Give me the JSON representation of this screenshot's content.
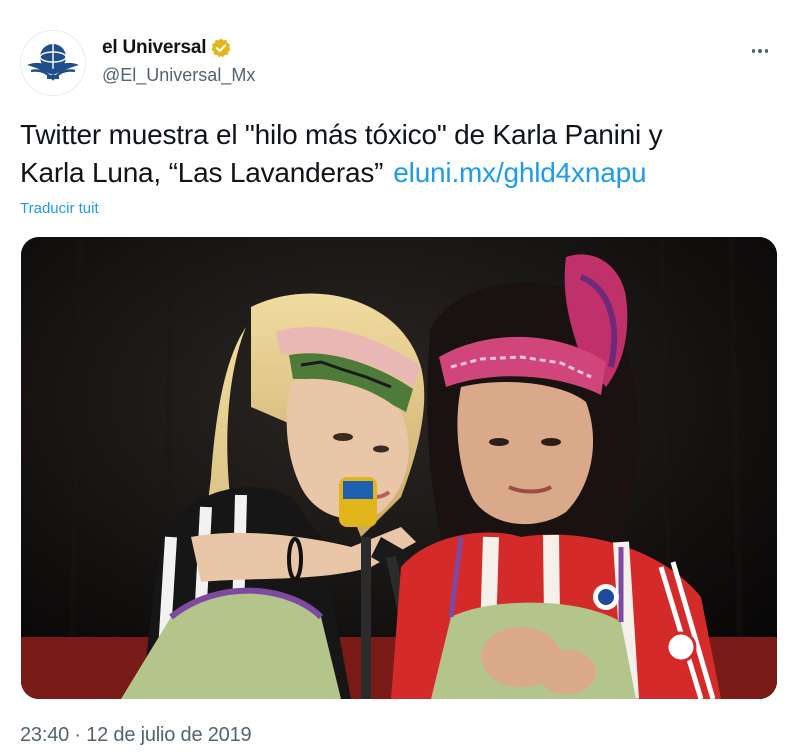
{
  "account": {
    "display_name": "el Universal",
    "handle": "@El_Universal_Mx",
    "verified": true,
    "avatar_icon": "el-universal-logo-icon"
  },
  "menu": {
    "more_icon": "more-options-icon"
  },
  "tweet": {
    "text_line1": "Twitter muestra el \"hilo más tóxico\" de Karla Panini y",
    "text_line2": "Karla Luna, “Las Lavanderas”",
    "link_text": "eluni.mx/ghld4xnapu",
    "translate_label": "Traducir tuit",
    "timestamp": "23:40 · 12 de julio de 2019"
  },
  "colors": {
    "link": "#1d9bf0",
    "secondary_text": "#536471",
    "primary_text": "#0f1419",
    "verified_badge": "#e2b719"
  }
}
